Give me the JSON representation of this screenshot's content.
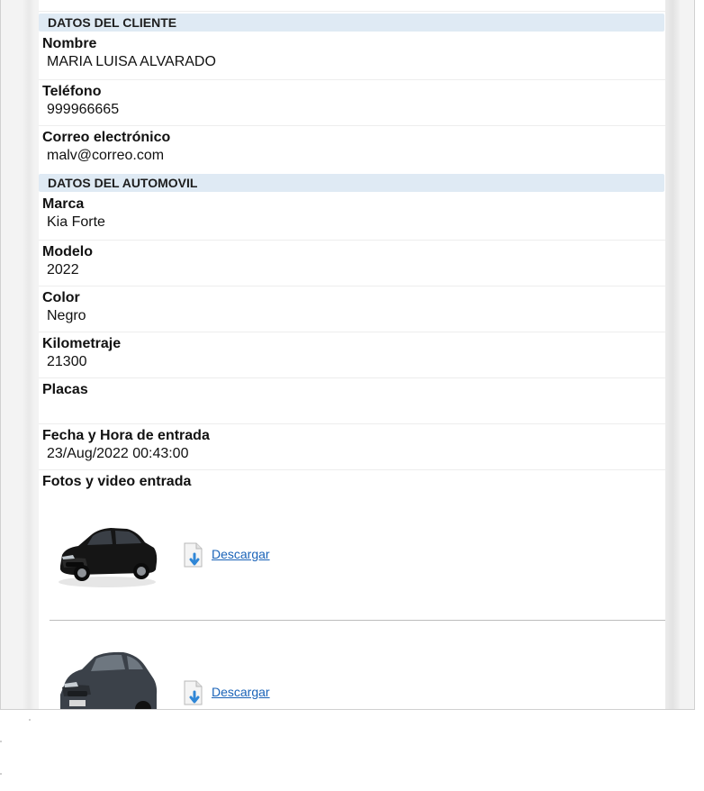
{
  "cliente": {
    "header": "DATOS DEL CLIENTE",
    "fields": [
      {
        "label": "Nombre",
        "value": "MARIA LUISA ALVARADO"
      },
      {
        "label": "Teléfono",
        "value": "999966665"
      },
      {
        "label": "Correo electrónico",
        "value": "malv@correo.com"
      }
    ]
  },
  "automovil": {
    "header": "DATOS DEL AUTOMOVIL",
    "fields": [
      {
        "label": "Marca",
        "value": "Kia Forte"
      },
      {
        "label": "Modelo",
        "value": "2022"
      },
      {
        "label": "Color",
        "value": "Negro"
      },
      {
        "label": "Kilometraje",
        "value": "21300"
      },
      {
        "label": "Placas",
        "value": ""
      },
      {
        "label": "Fecha y Hora de entrada",
        "value": "23/Aug/2022 00:43:00"
      }
    ]
  },
  "media": {
    "label": "Fotos y video entrada",
    "items": [
      {
        "thumb_icon": "black-sedan-photo",
        "file_icon": "download-file-icon",
        "link": "Descargar"
      },
      {
        "thumb_icon": "gray-hatchback-photo",
        "file_icon": "download-file-icon",
        "link": "Descargar"
      }
    ]
  },
  "colors": {
    "section_header_bg": "#dfeaf4",
    "link": "#1a63b8"
  }
}
